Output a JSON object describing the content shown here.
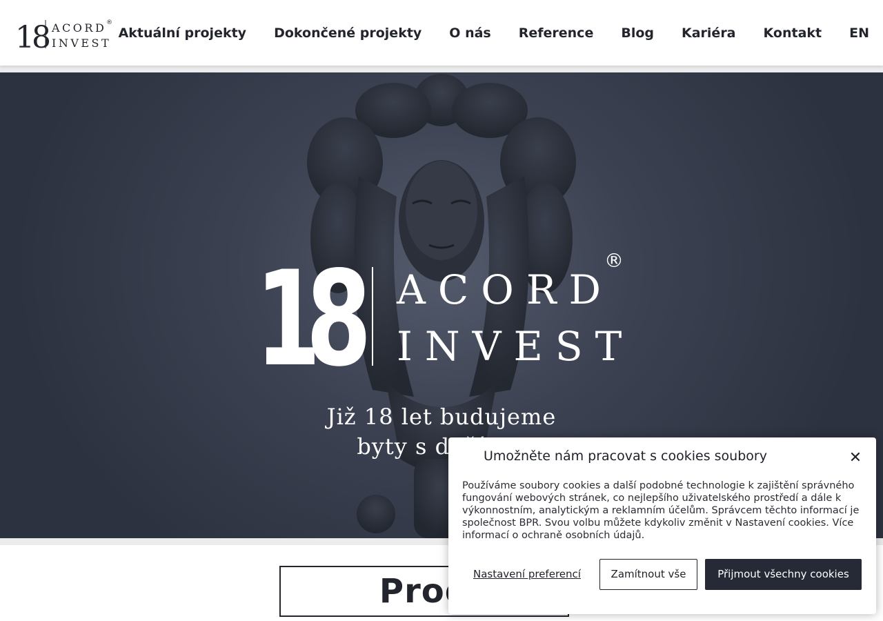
{
  "brand": {
    "logo_number": "18",
    "logo_line1": "ACORD",
    "logo_line2": "INVEST",
    "registered": "®"
  },
  "nav": {
    "items": [
      {
        "label": "Aktuální projekty"
      },
      {
        "label": "Dokončené projekty"
      },
      {
        "label": "O nás"
      },
      {
        "label": "Reference"
      },
      {
        "label": "Blog"
      },
      {
        "label": "Kariéra"
      },
      {
        "label": "Kontakt"
      },
      {
        "label": "EN"
      }
    ]
  },
  "hero": {
    "tagline_line1": "Již 18 let budujeme",
    "tagline_line2": "byty s duší v c"
  },
  "section": {
    "title": "Prod"
  },
  "cookie": {
    "title": "Umožněte nám pracovat s cookies soubory",
    "close_icon": "close-icon",
    "text": "Používáme soubory cookies a další podobné technologie k zajištění správného fungování webových stránek, co nejlepšího uživatelského prostředí a dále k výkonnostním, analytickým a reklamním účelům. Správcem těchto informací je společnost BPR. Svou volbu můžete kdykoliv změnit v Nastavení cookies. Více informací o ochraně osobních údajů.",
    "preferences_label": "Nastavení preferencí",
    "reject_label": "Zamítnout vše",
    "accept_label": "Přijmout všechny cookies"
  },
  "colors": {
    "text_dark": "#22252c",
    "hero_bg": "#3c4252",
    "accept_button": "#252a36",
    "white": "#ffffff"
  }
}
